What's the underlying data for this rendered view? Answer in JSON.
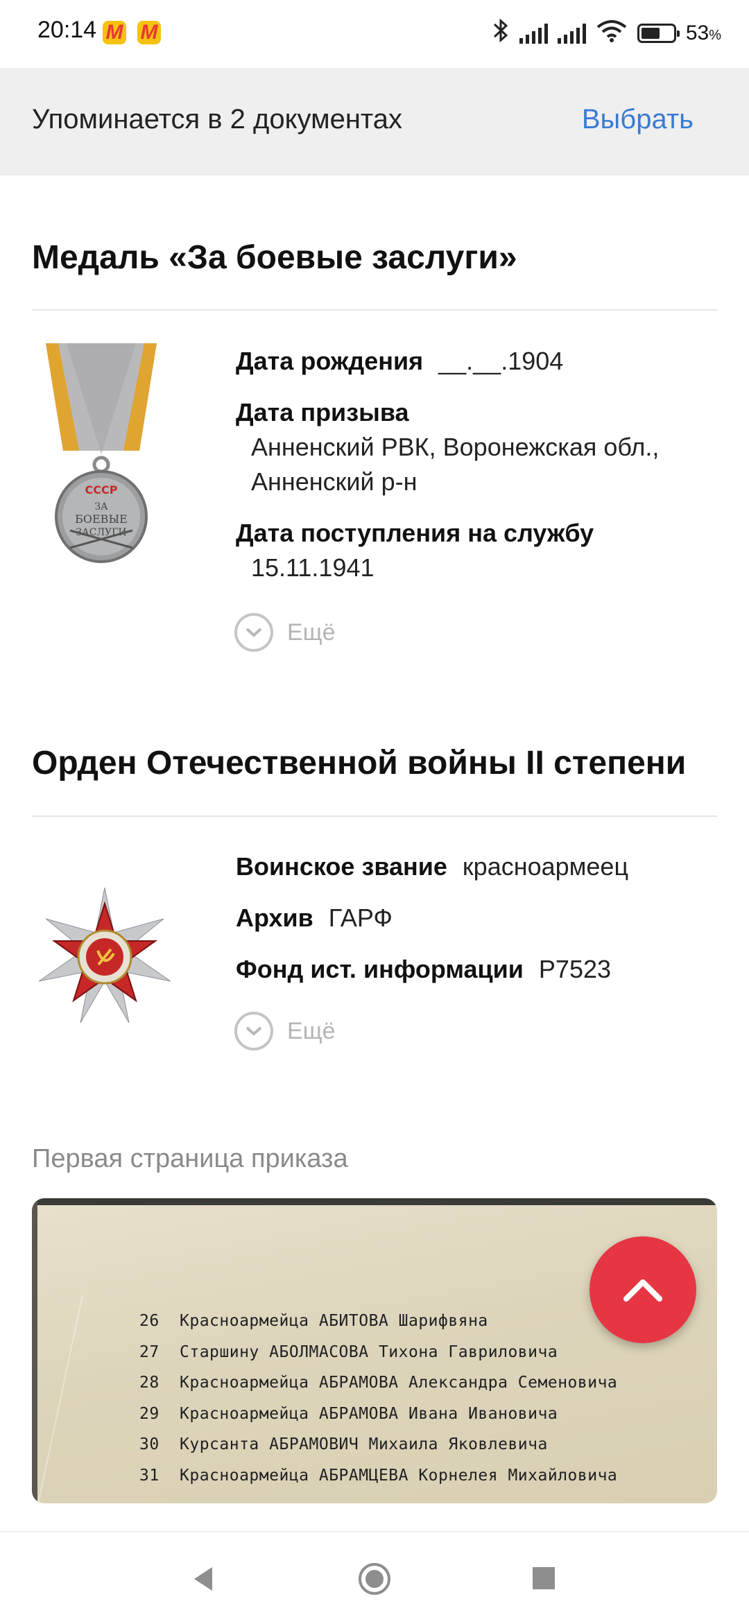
{
  "status_bar": {
    "time": "20:14",
    "app_icons": [
      "yandex-market-icon",
      "yandex-market-icon"
    ],
    "battery_percent": "53",
    "percent_sign": "%"
  },
  "banner": {
    "text": "Упоминается в 2 документах",
    "action": "Выбрать"
  },
  "awards": [
    {
      "title": "Медаль «За боевые заслуги»",
      "fields": {
        "birth_label": "Дата рождения",
        "birth_value": "__.__.1904",
        "draft_label": "Дата призыва",
        "draft_value_line1": "Анненский РВК, Воронежская обл.,",
        "draft_value_line2": "Анненский р-н",
        "service_label": "Дата поступления на службу",
        "service_value": "15.11.1941"
      },
      "more": "Ещё",
      "medal": {
        "top": "СССР",
        "line1": "ЗА",
        "line2": "БОЕВЫЕ",
        "line3": "ЗАСЛУГИ"
      }
    },
    {
      "title": "Орден Отечественной войны II степени",
      "fields": {
        "rank_label": "Воинское звание",
        "rank_value": "красноармеец",
        "archive_label": "Архив",
        "archive_value": "ГАРФ",
        "fund_label": "Фонд ист. информации",
        "fund_value": "Р7523"
      },
      "more": "Ещё"
    }
  ],
  "first_page": {
    "label": "Первая страница приказа",
    "rows": [
      {
        "n": "26",
        "text": "Красноармейца АБИТОВА Шарифвяна"
      },
      {
        "n": "27",
        "text": "Старшину АБОЛМАСОВА Тихона Гавриловича"
      },
      {
        "n": "28",
        "text": "Красноармейца АБРАМОВА Александра Семеновича"
      },
      {
        "n": "29",
        "text": "Красноармейца АБРАМОВА Ивана Ивановича"
      },
      {
        "n": "30",
        "text": "Курсанта АБРАМОВИЧ Михаила Яковлевича"
      },
      {
        "n": "31",
        "text": "Красноармейца АБРАМЦЕВА Корнелея Михайловича"
      }
    ]
  },
  "colors": {
    "accent_link": "#3a7bd5",
    "fab": "#e63643",
    "banner_bg": "#efefef"
  }
}
